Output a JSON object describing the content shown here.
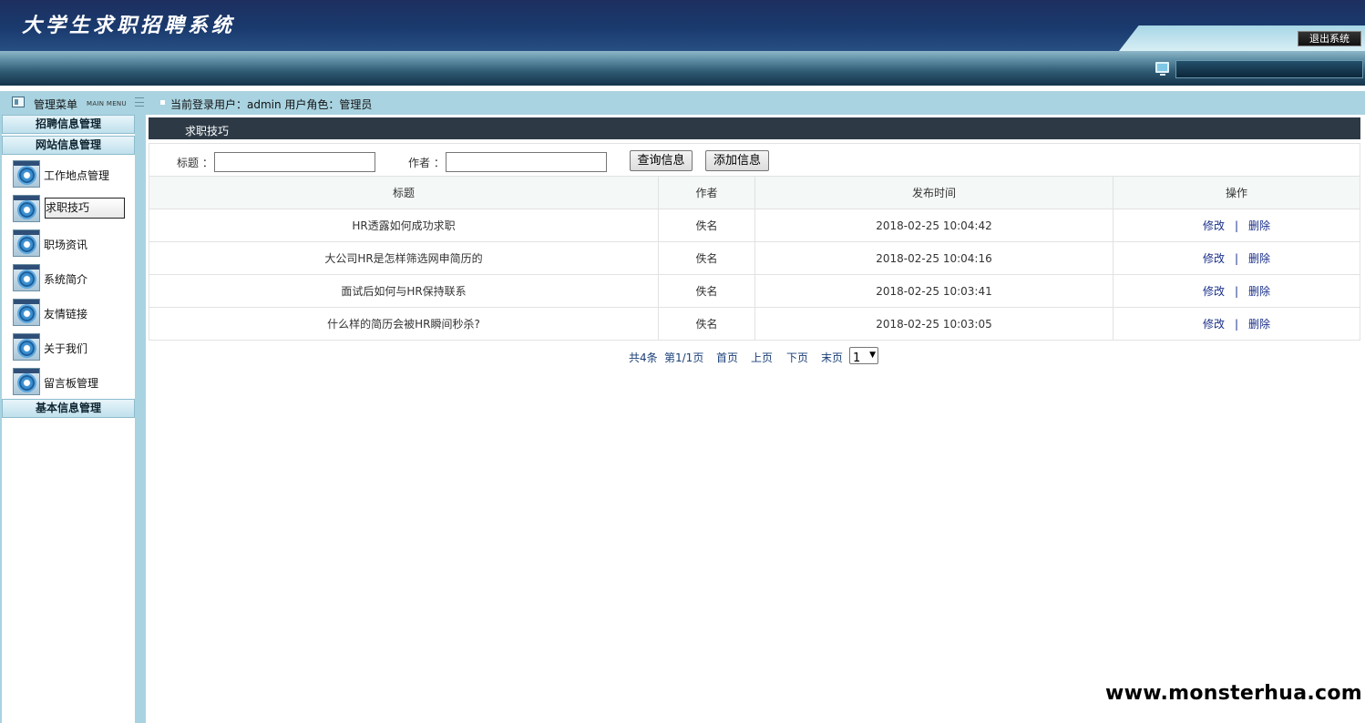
{
  "header": {
    "app_title": "大学生求职招聘系统",
    "logout_label": "退出系统"
  },
  "status": {
    "menu_title": "管理菜单",
    "menu_subtitle": "MAIN MENU",
    "user_info": "当前登录用户：admin  用户角色：管理员"
  },
  "sidebar": {
    "groups": [
      {
        "label": "招聘信息管理"
      },
      {
        "label": "网站信息管理"
      },
      {
        "label": "基本信息管理"
      }
    ],
    "items": [
      {
        "label": "工作地点管理",
        "icon": "gear-window-icon"
      },
      {
        "label": "求职技巧",
        "icon": "gear-window-icon",
        "active": true
      },
      {
        "label": "职场资讯",
        "icon": "gear-window-icon"
      },
      {
        "label": "系统简介",
        "icon": "gear-window-icon"
      },
      {
        "label": "友情链接",
        "icon": "gear-window-icon"
      },
      {
        "label": "关于我们",
        "icon": "gear-window-icon"
      },
      {
        "label": "留言板管理",
        "icon": "gear-window-icon"
      }
    ]
  },
  "main": {
    "section_title": "求职技巧",
    "search": {
      "title_label": "标题 ：",
      "title_value": "",
      "author_label": "作者 ：",
      "author_value": "",
      "query_button": "查询信息",
      "add_button": "添加信息"
    },
    "table": {
      "columns": [
        "标题",
        "作者",
        "发布时间",
        "操作"
      ],
      "rows": [
        {
          "title": "HR透露如何成功求职",
          "author": "佚名",
          "time": "2018-02-25 10:04:42"
        },
        {
          "title": "大公司HR是怎样筛选网申简历的",
          "author": "佚名",
          "time": "2018-02-25 10:04:16"
        },
        {
          "title": "面试后如何与HR保持联系",
          "author": "佚名",
          "time": "2018-02-25 10:03:41"
        },
        {
          "title": "什么样的简历会被HR瞬间秒杀?",
          "author": "佚名",
          "time": "2018-02-25 10:03:05"
        }
      ],
      "edit_label": "修改",
      "divider": "|",
      "delete_label": "删除"
    },
    "pager": {
      "total": "共4条",
      "page_info": "第1/1页",
      "first": "首页",
      "prev": "上页",
      "next": "下页",
      "last": "末页",
      "selected_page": "1"
    }
  },
  "watermark": "www.monsterhua.com",
  "colors": {
    "banner": "#1d2f5f",
    "frame": "#a9d3e0",
    "section_bar": "#2d3a46",
    "link": "#1a2f8a"
  }
}
